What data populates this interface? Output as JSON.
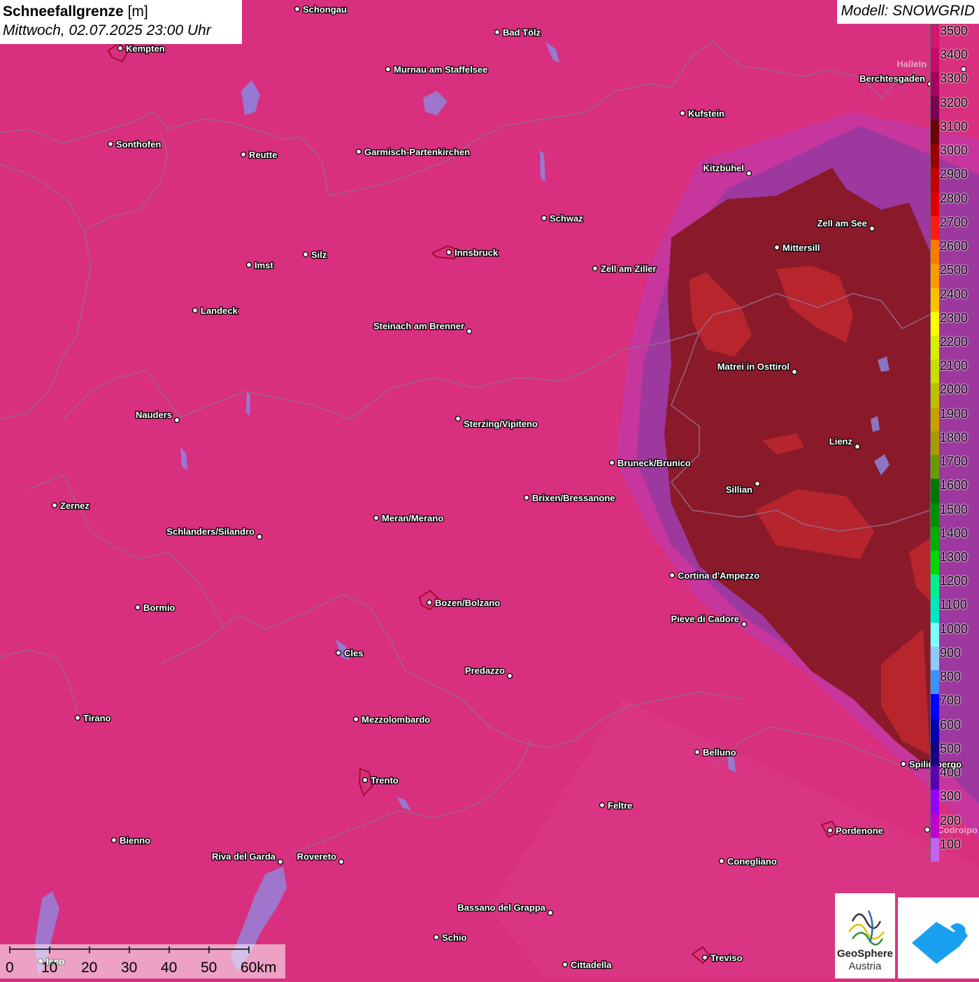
{
  "title": {
    "parameter": "Schneefallgrenze",
    "unit": "[m]",
    "datetime": "Mittwoch, 02.07.2025 23:00 Uhr"
  },
  "model_label": "Modell: SNOWGRID",
  "legend": {
    "levels": [
      3500,
      3400,
      3300,
      3200,
      3100,
      3000,
      2900,
      2800,
      2700,
      2600,
      2500,
      2400,
      2300,
      2200,
      2100,
      2000,
      1900,
      1800,
      1700,
      1600,
      1500,
      1400,
      1300,
      1200,
      1100,
      1000,
      900,
      800,
      700,
      600,
      500,
      400,
      300,
      200,
      100
    ],
    "colors": [
      "#d4146e",
      "#c80a6a",
      "#a80060",
      "#7a0050",
      "#6a0000",
      "#9a0000",
      "#c40000",
      "#e00000",
      "#ff1a1a",
      "#ff7a00",
      "#ff9900",
      "#ffc000",
      "#ffff00",
      "#d8f000",
      "#c8e000",
      "#c0c000",
      "#c8a000",
      "#a89a00",
      "#6a9a00",
      "#007800",
      "#009000",
      "#00b000",
      "#00d800",
      "#00f090",
      "#00e8c0",
      "#80ffff",
      "#90c8ff",
      "#4090ff",
      "#0000ff",
      "#0000b0",
      "#1a0080",
      "#5a00b0",
      "#9a00ff",
      "#c000d0",
      "#c860f0"
    ]
  },
  "cities": [
    {
      "name": "Schongau"
    },
    {
      "name": "Bad Tölz"
    },
    {
      "name": "Kempten"
    },
    {
      "name": "Murnau am Staffelsee"
    },
    {
      "name": "Berchtesgaden"
    },
    {
      "name": "Kufstein"
    },
    {
      "name": "Sonthofen"
    },
    {
      "name": "Reutte"
    },
    {
      "name": "Garmisch-Partenkirchen"
    },
    {
      "name": "Kitzbühel"
    },
    {
      "name": "Schwaz"
    },
    {
      "name": "Zell am See"
    },
    {
      "name": "Mittersill"
    },
    {
      "name": "Innsbruck"
    },
    {
      "name": "Silz"
    },
    {
      "name": "Imst"
    },
    {
      "name": "Zell am Ziller"
    },
    {
      "name": "Landeck"
    },
    {
      "name": "Steinach am Brenner"
    },
    {
      "name": "Matrei in Osttirol"
    },
    {
      "name": "Nauders"
    },
    {
      "name": "Sterzing/Vipiteno"
    },
    {
      "name": "Lienz"
    },
    {
      "name": "Bruneck/Brunico"
    },
    {
      "name": "Sillian"
    },
    {
      "name": "Zernez"
    },
    {
      "name": "Brixen/Bressanone"
    },
    {
      "name": "Meran/Merano"
    },
    {
      "name": "Schlanders/Silandro"
    },
    {
      "name": "Cortina d'Ampezzo"
    },
    {
      "name": "Bormio"
    },
    {
      "name": "Bozen/Bolzano"
    },
    {
      "name": "Pieve di Cadore"
    },
    {
      "name": "Cles"
    },
    {
      "name": "Predazzo"
    },
    {
      "name": "Tirano"
    },
    {
      "name": "Mezzolombardo"
    },
    {
      "name": "Belluno"
    },
    {
      "name": "Spilimbergo"
    },
    {
      "name": "Trento"
    },
    {
      "name": "Feltre"
    },
    {
      "name": "Pordenone"
    },
    {
      "name": "Bienno"
    },
    {
      "name": "Riva del Garda"
    },
    {
      "name": "Rovereto"
    },
    {
      "name": "Conegliano"
    },
    {
      "name": "Bassano del Grappa"
    },
    {
      "name": "Schio"
    },
    {
      "name": "Treviso"
    },
    {
      "name": "Cittadella"
    },
    {
      "name": "Iseo"
    }
  ],
  "faint_labels": [
    "Hallein",
    "Codroipo"
  ],
  "scale_bar": {
    "ticks": [
      "0",
      "10",
      "20",
      "30",
      "40",
      "50",
      "60km"
    ]
  },
  "logos": {
    "geosphere_line1": "GeoSphere",
    "geosphere_line2": "Austria"
  }
}
